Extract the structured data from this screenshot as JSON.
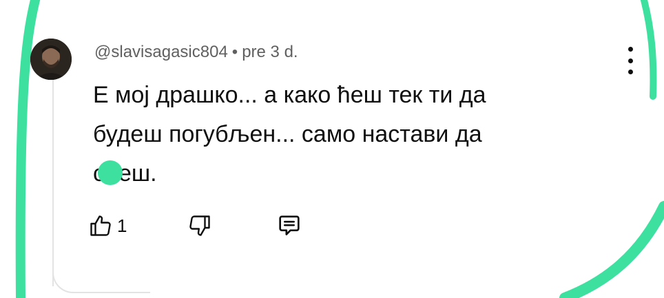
{
  "comment": {
    "author": "@slavisagasic804",
    "separator": "•",
    "time": "pre 3 d.",
    "text_lines": [
      "Е мој драшко... а како ћеш тек ти да",
      "будеш погубљен... само настави да",
      "с",
      "еш."
    ],
    "avatar_icon": "user-avatar",
    "menu_icon": "more-vertical-icon"
  },
  "actions": {
    "like_icon": "thumb-up-icon",
    "like_count": "1",
    "dislike_icon": "thumb-down-icon",
    "reply_icon": "comment-reply-icon"
  },
  "colors": {
    "accent_green": "#3ee0a0",
    "text": "#0f0f0f",
    "meta_text": "#606060"
  }
}
